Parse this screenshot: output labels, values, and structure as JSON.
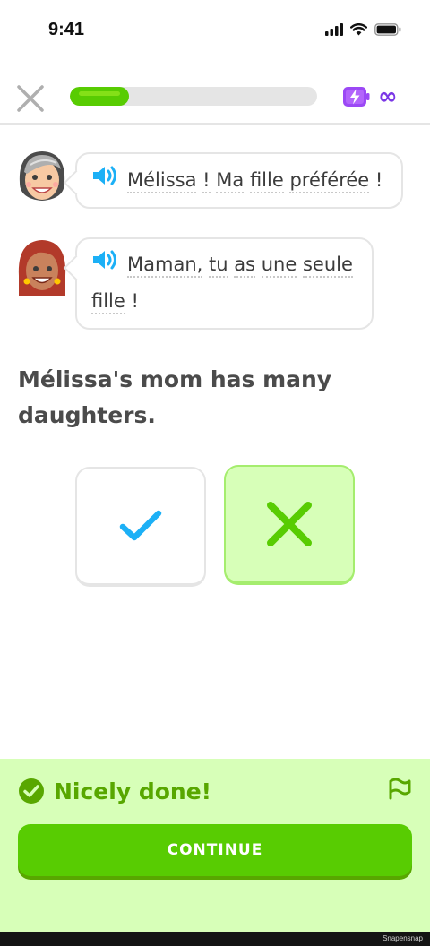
{
  "status_bar": {
    "time": "9:41",
    "icons": [
      "signal-icon",
      "wifi-icon",
      "battery-icon"
    ]
  },
  "header": {
    "progress": 0.24,
    "energy_symbol": "∞",
    "icons": [
      "close-icon",
      "energy-icon",
      "infinity-icon"
    ]
  },
  "conversation": [
    {
      "speaker": "grandmother",
      "words": [
        "Mélissa",
        "!",
        "Ma",
        "fille",
        "préférée",
        "!"
      ]
    },
    {
      "speaker": "melissa",
      "words": [
        "Maman,",
        "tu",
        "as",
        "une",
        "seule",
        "fille",
        "!"
      ]
    }
  ],
  "prompt": "Mélissa's mom has many daughters.",
  "choices": [
    {
      "name": "true",
      "icon": "check-icon",
      "selected": false
    },
    {
      "name": "false",
      "icon": "x-icon",
      "selected": true
    }
  ],
  "footer": {
    "result": "Nicely done!",
    "continue_label": "CONTINUE"
  },
  "watermark": "Snapensnap",
  "colors": {
    "green": "#58cc02",
    "dark_green": "#58a700",
    "light_green": "#d7ffb8",
    "blue": "#1cb0f6",
    "purple": "#9b48f5"
  }
}
